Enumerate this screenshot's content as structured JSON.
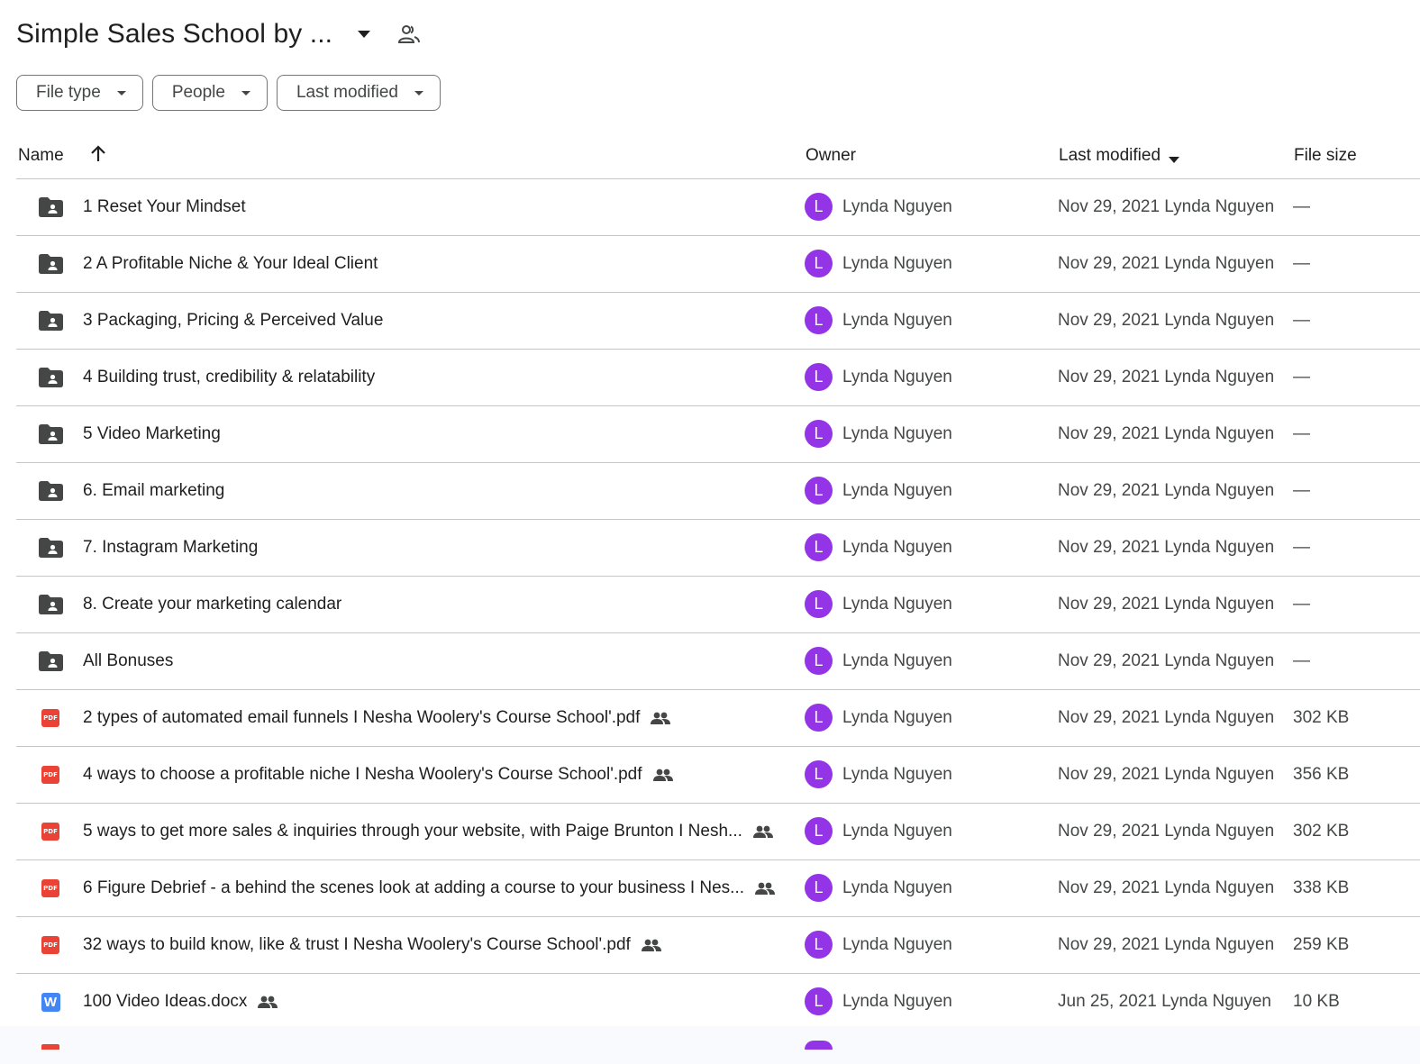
{
  "header": {
    "title": "Simple Sales School by ..."
  },
  "filters": [
    {
      "label": "File type"
    },
    {
      "label": "People"
    },
    {
      "label": "Last modified"
    }
  ],
  "columns": {
    "name": "Name",
    "owner": "Owner",
    "modified": "Last modified",
    "size": "File size"
  },
  "rows": [
    {
      "type": "folder",
      "name": "1 Reset Your Mindset",
      "owner": "Lynda Nguyen",
      "avatar": "L",
      "modified": "Nov 29, 2021 Lynda Nguyen",
      "size": "—"
    },
    {
      "type": "folder",
      "name": "2 A Profitable Niche & Your Ideal Client",
      "owner": "Lynda Nguyen",
      "avatar": "L",
      "modified": "Nov 29, 2021 Lynda Nguyen",
      "size": "—"
    },
    {
      "type": "folder",
      "name": "3 Packaging, Pricing & Perceived Value",
      "owner": "Lynda Nguyen",
      "avatar": "L",
      "modified": "Nov 29, 2021 Lynda Nguyen",
      "size": "—"
    },
    {
      "type": "folder",
      "name": "4 Building trust, credibility & relatability",
      "owner": "Lynda Nguyen",
      "avatar": "L",
      "modified": "Nov 29, 2021 Lynda Nguyen",
      "size": "—"
    },
    {
      "type": "folder",
      "name": "5 Video Marketing",
      "owner": "Lynda Nguyen",
      "avatar": "L",
      "modified": "Nov 29, 2021 Lynda Nguyen",
      "size": "—"
    },
    {
      "type": "folder",
      "name": "6. Email marketing",
      "owner": "Lynda Nguyen",
      "avatar": "L",
      "modified": "Nov 29, 2021 Lynda Nguyen",
      "size": "—"
    },
    {
      "type": "folder",
      "name": "7. Instagram Marketing",
      "owner": "Lynda Nguyen",
      "avatar": "L",
      "modified": "Nov 29, 2021 Lynda Nguyen",
      "size": "—"
    },
    {
      "type": "folder",
      "name": "8. Create your marketing calendar",
      "owner": "Lynda Nguyen",
      "avatar": "L",
      "modified": "Nov 29, 2021 Lynda Nguyen",
      "size": "—"
    },
    {
      "type": "folder",
      "name": "All Bonuses",
      "owner": "Lynda Nguyen",
      "avatar": "L",
      "modified": "Nov 29, 2021 Lynda Nguyen",
      "size": "—"
    },
    {
      "type": "pdf",
      "badge": "PDF",
      "shared": true,
      "name": "2 types of automated email funnels I Nesha Woolery's Course School'.pdf",
      "owner": "Lynda Nguyen",
      "avatar": "L",
      "modified": "Nov 29, 2021 Lynda Nguyen",
      "size": "302 KB"
    },
    {
      "type": "pdf",
      "badge": "PDF",
      "shared": true,
      "name": "4 ways to choose a profitable niche I Nesha Woolery's Course School'.pdf",
      "owner": "Lynda Nguyen",
      "avatar": "L",
      "modified": "Nov 29, 2021 Lynda Nguyen",
      "size": "356 KB"
    },
    {
      "type": "pdf",
      "badge": "PDF",
      "shared": true,
      "name": "5 ways to get more sales & inquiries through your website, with Paige Brunton I Nesh...",
      "owner": "Lynda Nguyen",
      "avatar": "L",
      "modified": "Nov 29, 2021 Lynda Nguyen",
      "size": "302 KB"
    },
    {
      "type": "pdf",
      "badge": "PDF",
      "shared": true,
      "name": "6 Figure Debrief - a behind the scenes look at adding a course to your business I Nes...",
      "owner": "Lynda Nguyen",
      "avatar": "L",
      "modified": "Nov 29, 2021 Lynda Nguyen",
      "size": "338 KB"
    },
    {
      "type": "pdf",
      "badge": "PDF",
      "shared": true,
      "name": "32 ways to build know, like & trust I Nesha Woolery's Course School'.pdf",
      "owner": "Lynda Nguyen",
      "avatar": "L",
      "modified": "Nov 29, 2021 Lynda Nguyen",
      "size": "259 KB"
    },
    {
      "type": "word",
      "badge": "W",
      "shared": true,
      "name": "100 Video Ideas.docx",
      "owner": "Lynda Nguyen",
      "avatar": "L",
      "modified": "Jun 25, 2021 Lynda Nguyen",
      "size": "10 KB"
    }
  ],
  "icons": {
    "title_caret": "caret-down-icon",
    "title_share": "shared-people-icon",
    "sort": "arrow-up-icon",
    "folder": "shared-folder-icon",
    "pdf": "pdf-file-icon",
    "word": "word-doc-icon",
    "shared": "shared-people-icon"
  },
  "colors": {
    "avatar": "#9334e6",
    "pdf": "#ea4335",
    "word": "#4285f4",
    "folder": "#444746",
    "divider": "#c4c7c5"
  }
}
